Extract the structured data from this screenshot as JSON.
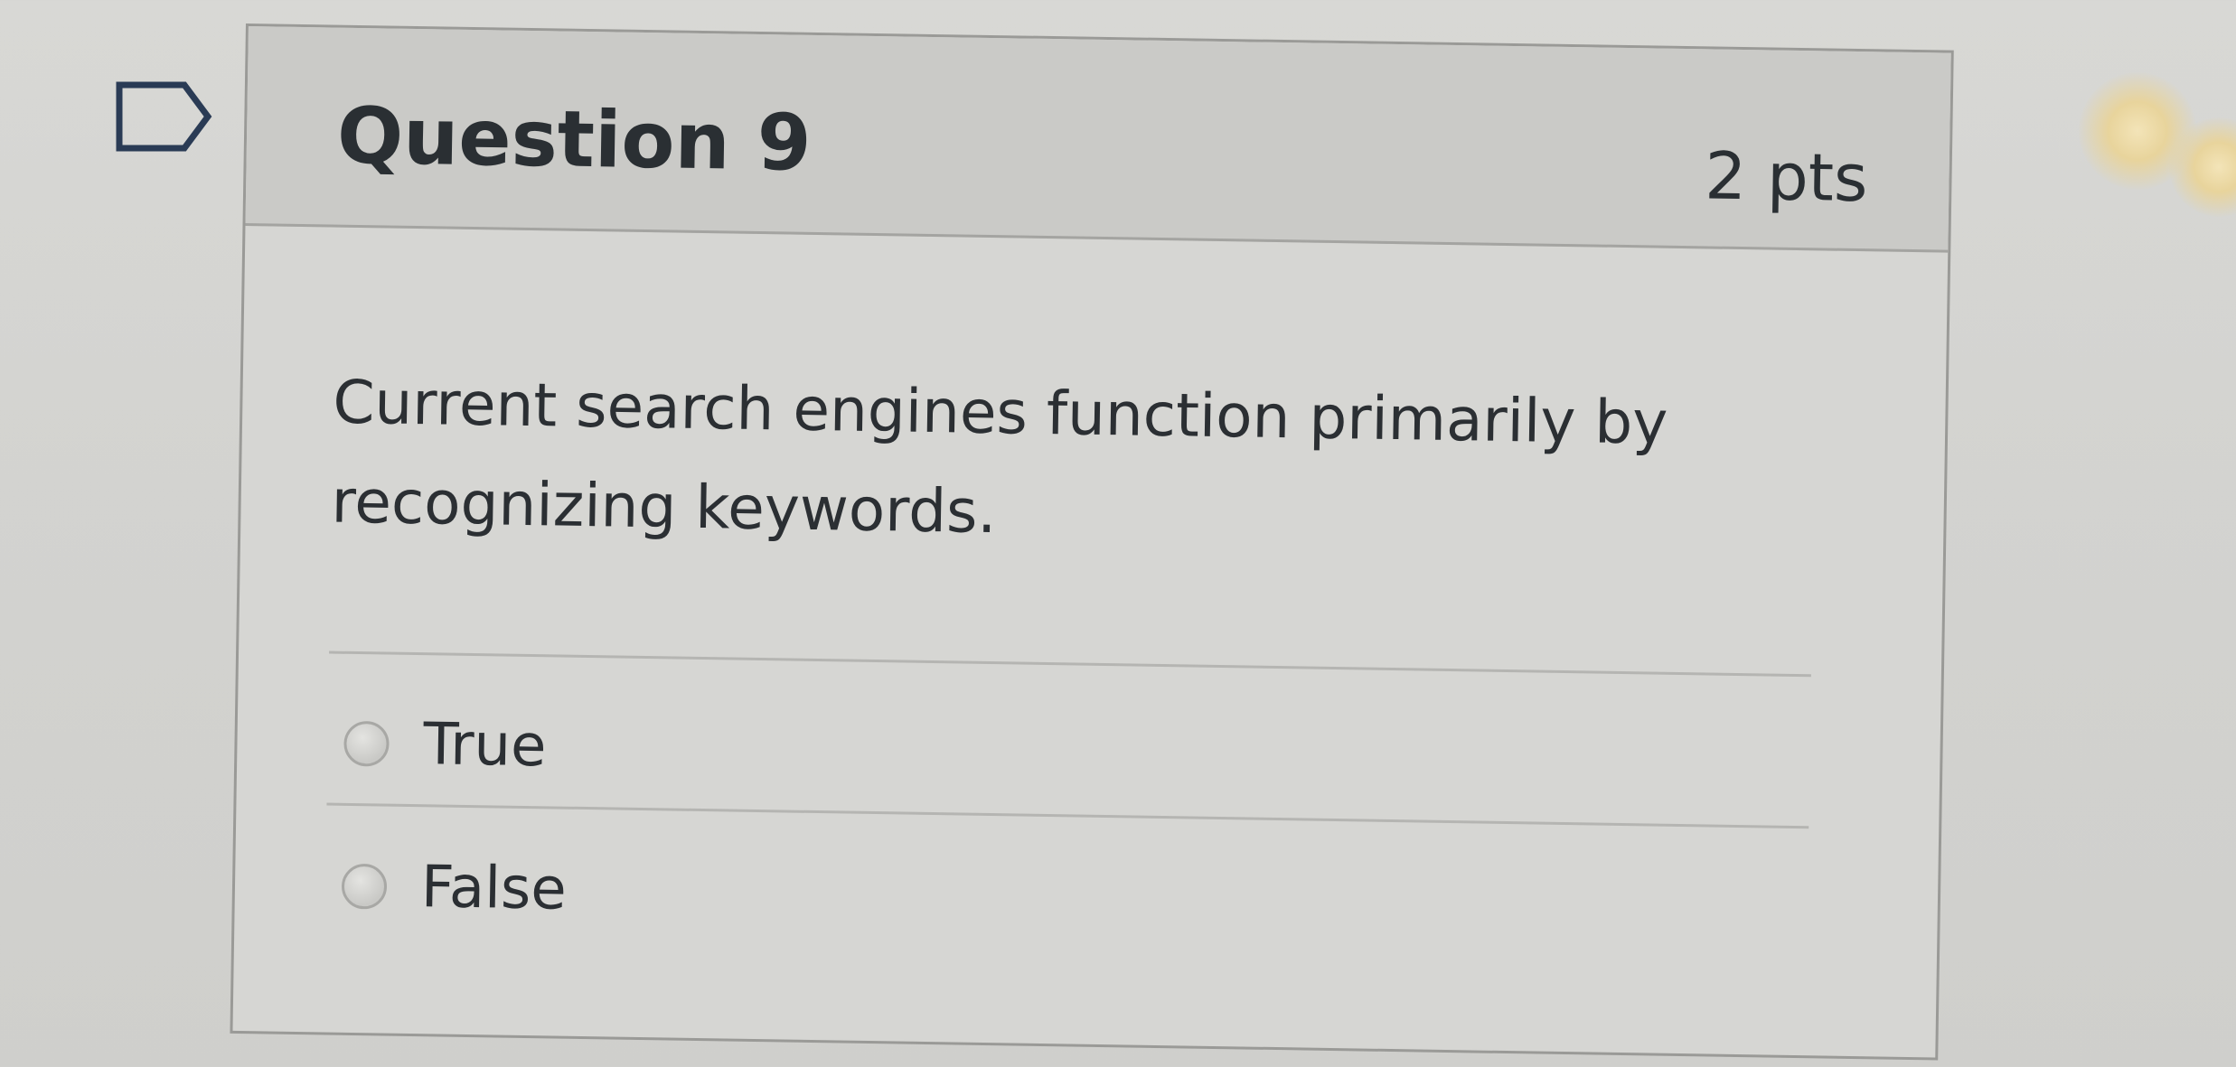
{
  "question": {
    "title": "Question 9",
    "points": "2 pts",
    "text": "Current search engines function primarily by recognizing keywords."
  },
  "answers": [
    {
      "label": "True",
      "selected": false
    },
    {
      "label": "False",
      "selected": false
    }
  ],
  "icons": {
    "flag": "flag-outline-icon"
  },
  "colors": {
    "header_bg": "#cacac7",
    "card_border": "#9a9a97",
    "text": "#2b2f33"
  }
}
